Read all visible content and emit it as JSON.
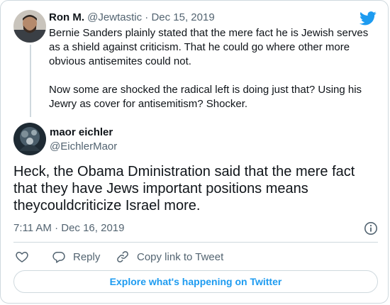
{
  "colors": {
    "accent": "#1d9bf0",
    "muted": "#536471",
    "text": "#0f1419",
    "border": "#cfd9de"
  },
  "parent_tweet": {
    "name": "Ron M.",
    "handle": "@Jewtastic",
    "separator": "·",
    "date": "Dec 15, 2019",
    "paragraphs": [
      "Bernie Sanders plainly stated that the mere fact he is Jewish serves as a shield against criticism. That he could go where other more obvious antisemites could not.",
      "Now some are shocked the radical left is doing just that? Using his Jewry as cover for antisemitism? Shocker."
    ]
  },
  "main_tweet": {
    "name": "maor eichler",
    "handle": "@EichlerMaor",
    "text": "Heck, the Obama Dministration said that the mere fact that they have Jews important positions means theycouldcriticize Israel more.",
    "timestamp": "7:11 AM · Dec 16, 2019"
  },
  "actions": {
    "like_icon": "heart-icon",
    "reply_label": "Reply",
    "copy_label": "Copy link to Tweet"
  },
  "explore_label": "Explore what's happening on Twitter",
  "icons": {
    "brand": "twitter-bird-icon",
    "info": "info-icon"
  }
}
